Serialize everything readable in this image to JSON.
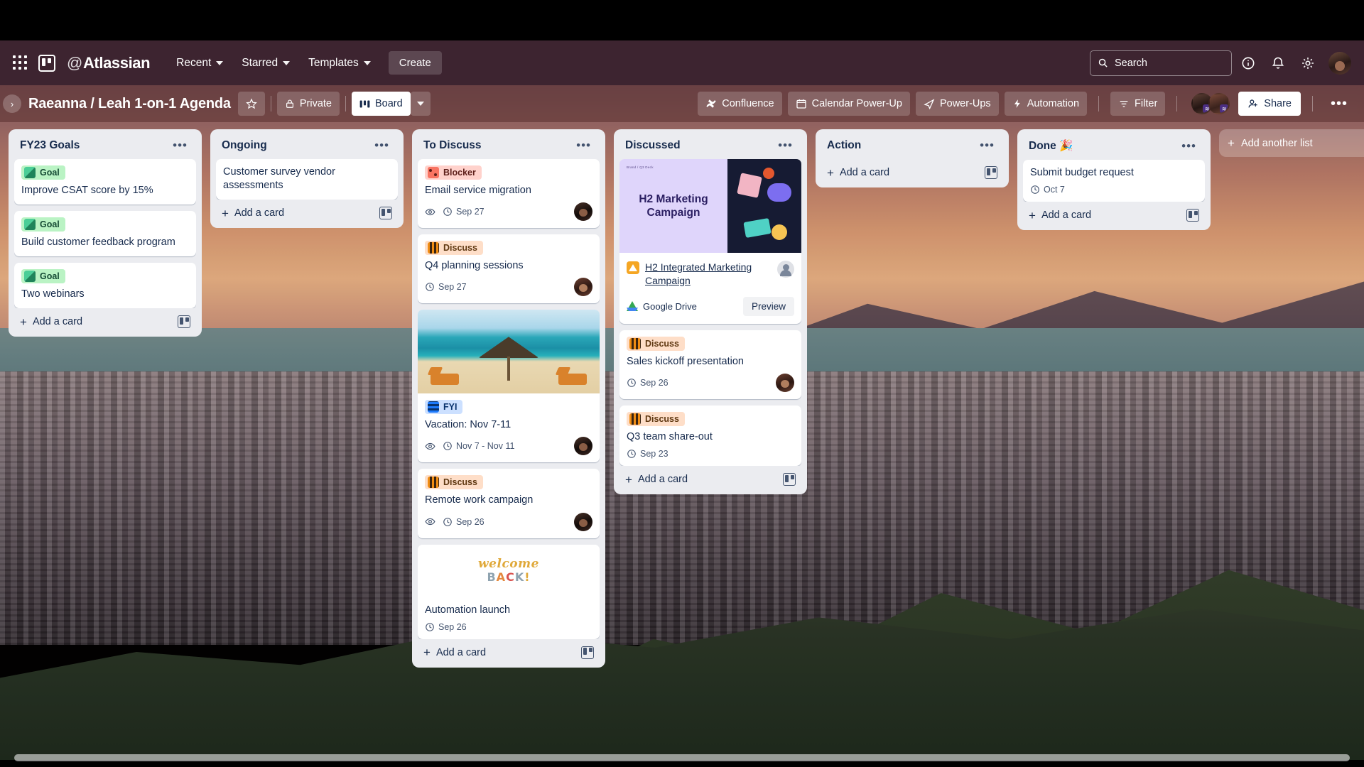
{
  "topnav": {
    "apps_icon": "app-switcher-icon",
    "product_logo": "trello-logo",
    "brand": "Atlassian",
    "brand_at": "@",
    "items": [
      {
        "label": "Recent"
      },
      {
        "label": "Starred"
      },
      {
        "label": "Templates"
      }
    ],
    "create_label": "Create",
    "search_placeholder": "Search",
    "info_icon": "info-icon",
    "bell_icon": "notifications-icon",
    "gear_icon": "settings-icon",
    "avatar": "user-avatar"
  },
  "boardbar": {
    "sidebar_toggle": "›",
    "title": "Raeanna / Leah 1-on-1 Agenda",
    "star_icon": "star-icon",
    "visibility": "Private",
    "view": "Board",
    "view_chevron": "chevron-down-icon",
    "buttons": [
      {
        "label": "Confluence",
        "icon": "confluence-icon"
      },
      {
        "label": "Calendar Power-Up",
        "icon": "calendar-icon"
      },
      {
        "label": "Power-Ups",
        "icon": "rocket-icon"
      },
      {
        "label": "Automation",
        "icon": "bolt-icon"
      },
      {
        "label": "Filter",
        "icon": "filter-icon"
      }
    ],
    "share_label": "Share",
    "more_label": "•••"
  },
  "board": {
    "add_another_list": "Add another list",
    "add_card_label": "Add a card",
    "lists": [
      {
        "title": "FY23 Goals",
        "cards": [
          {
            "label": {
              "text": "Goal",
              "color": "green"
            },
            "title": "Improve CSAT score by 15%"
          },
          {
            "label": {
              "text": "Goal",
              "color": "green"
            },
            "title": "Build customer feedback program"
          },
          {
            "label": {
              "text": "Goal",
              "color": "green"
            },
            "title": "Two webinars"
          }
        ]
      },
      {
        "title": "Ongoing",
        "cards": [
          {
            "title": "Customer survey vendor assessments"
          }
        ]
      },
      {
        "title": "To Discuss",
        "cards": [
          {
            "label": {
              "text": "Blocker",
              "color": "red"
            },
            "title": "Email service migration",
            "watch": true,
            "due": "Sep 27",
            "avatar": "member-raeanna"
          },
          {
            "label": {
              "text": "Discuss",
              "color": "orange"
            },
            "title": "Q4 planning sessions",
            "due": "Sep 27",
            "avatar": "member-leah"
          },
          {
            "cover": "beach-photo",
            "label": {
              "text": "FYI",
              "color": "blue"
            },
            "title": "Vacation: Nov 7-11",
            "watch": true,
            "due": "Nov 7 - Nov 11",
            "avatar": "member-raeanna"
          },
          {
            "label": {
              "text": "Discuss",
              "color": "orange"
            },
            "title": "Remote work campaign",
            "watch": true,
            "due": "Sep 26",
            "avatar": "member-raeanna"
          },
          {
            "cover": "welcome-back-art",
            "title": "Automation launch",
            "due": "Sep 26"
          }
        ]
      },
      {
        "title": "Discussed",
        "attachment_card": {
          "cover_title": "H2 Marketing Campaign",
          "cover_tiny": "Brand / Q3 Deck",
          "link_text": "H2 Integrated Marketing Campaign",
          "source": "Google Drive",
          "preview_label": "Preview"
        },
        "cards": [
          {
            "label": {
              "text": "Discuss",
              "color": "orange"
            },
            "title": "Sales kickoff presentation",
            "due": "Sep 26",
            "avatar": "member-leah"
          },
          {
            "label": {
              "text": "Discuss",
              "color": "orange"
            },
            "title": "Q3 team share-out",
            "due": "Sep 23"
          }
        ]
      },
      {
        "title": "Action",
        "cards": []
      },
      {
        "title": "Done 🎉",
        "cards": [
          {
            "title": "Submit budget request",
            "due": "Oct 7"
          }
        ]
      }
    ]
  },
  "colors": {
    "topnav_bg": "#3d2430",
    "list_bg": "#ebecf0",
    "card_bg": "#ffffff",
    "text_primary": "#172b4d",
    "text_muted": "#44546f",
    "label_green": "#baf3c4",
    "label_red": "#ffd2cc",
    "label_orange": "#fedec8",
    "label_blue": "#cce0ff",
    "cover_purple": "#dfd5fb"
  }
}
